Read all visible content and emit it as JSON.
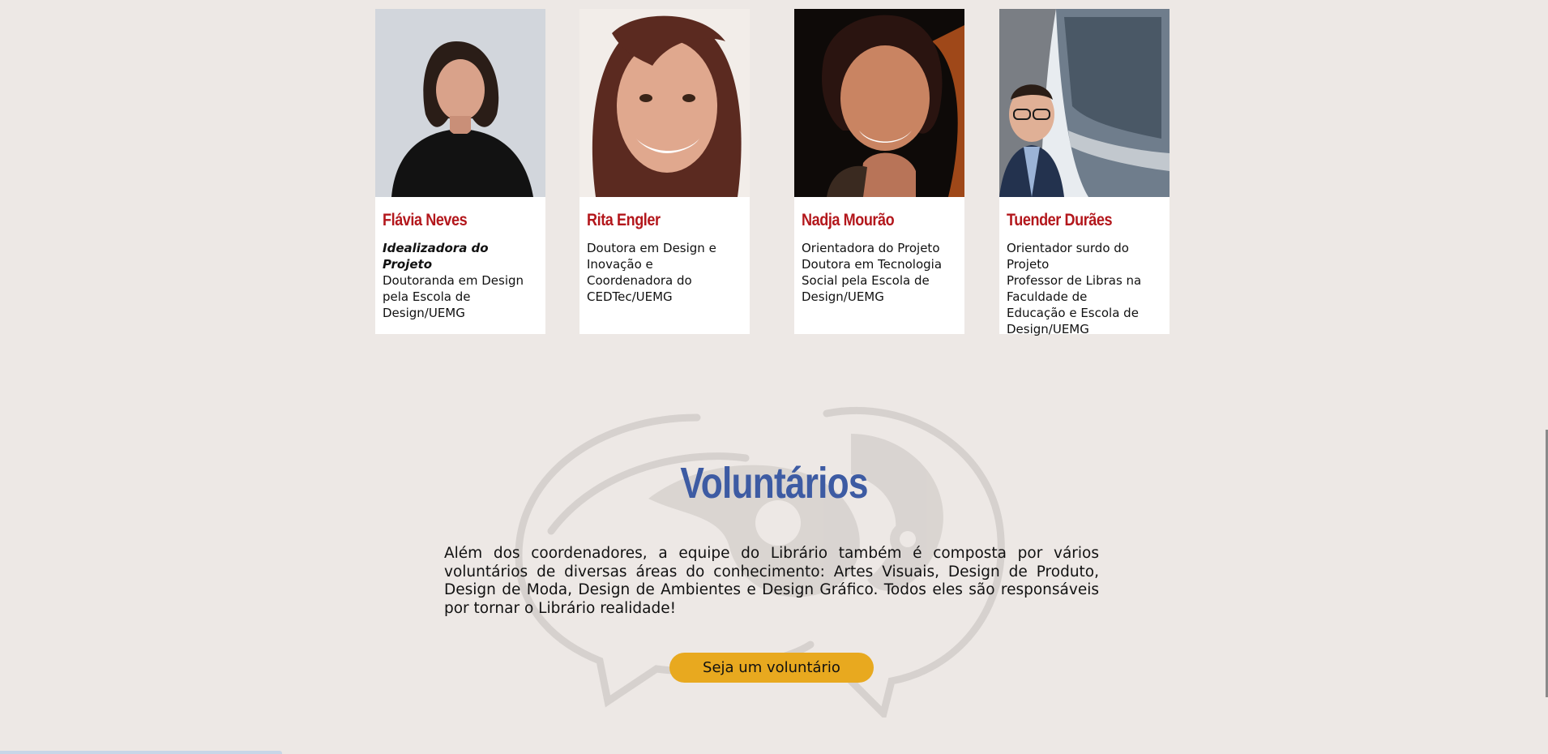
{
  "team": [
    {
      "name": "Flávia Neves",
      "role": "Idealizadora do Projeto",
      "description": "Doutoranda em Design\npela  Escola de\nDesign/UEMG"
    },
    {
      "name": "Rita Engler",
      "role": "",
      "description": "Doutora em Design e\nInovação e\nCoordenadora do\nCEDTec/UEMG"
    },
    {
      "name": "Nadja Mourão",
      "role": "",
      "description": "Orientadora do Projeto\nDoutora em Tecnologia\nSocial pela Escola de\nDesign/UEMG"
    },
    {
      "name": "Tuender Durães",
      "role": "",
      "description": "Orientador surdo do\nProjeto\nProfessor de Libras na\nFaculdade de\nEducação e Escola de\nDesign/UEMG"
    }
  ],
  "volunteers": {
    "title": "Voluntários",
    "text": "Além dos coordenadores, a equipe do Librário também é composta por vários voluntários de diversas áreas do conhecimento: Artes Visuais, Design de Produto, Design de Moda, Design de Ambientes e Design Gráfico. Todos eles são responsáveis por tornar o Librário realidade!",
    "button_label": "Seja um voluntário"
  },
  "colors": {
    "background": "#ede8e5",
    "name_red": "#b3171c",
    "title_blue": "#3d5ba3",
    "button_yellow": "#e8a91f"
  }
}
